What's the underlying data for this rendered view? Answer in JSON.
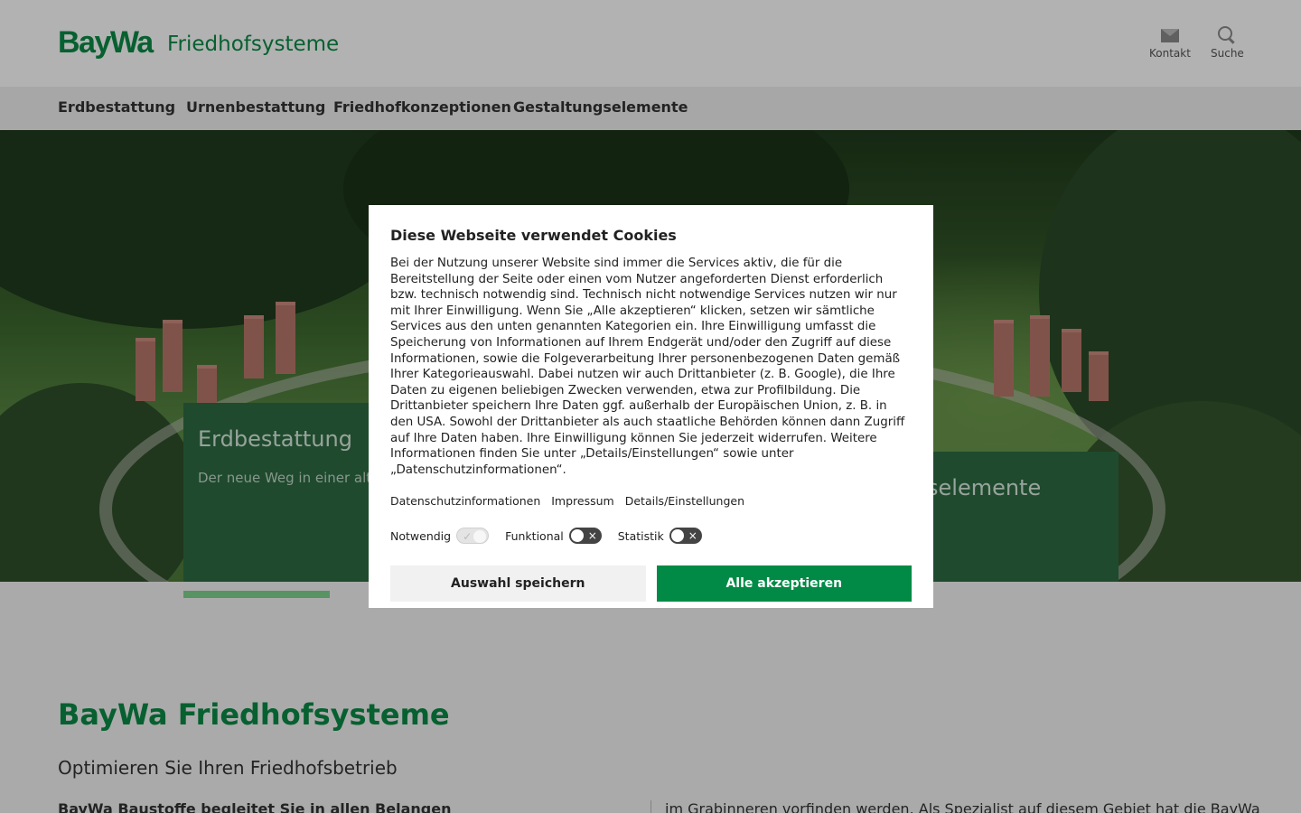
{
  "header": {
    "logo": "BayWa",
    "site_name": "Friedhofsysteme",
    "kontakt_label": "Kontakt",
    "suche_label": "Suche"
  },
  "nav": {
    "items": [
      {
        "label": "Erdbestattung"
      },
      {
        "label": "Urnenbestattung"
      },
      {
        "label": "Friedhofkonzeptionen"
      },
      {
        "label": "Gestaltungselemente"
      }
    ]
  },
  "hero": {
    "cards": [
      {
        "title": "Erdbestattung",
        "text": "Der neue Weg in einer alte"
      },
      {
        "title": "selemente"
      }
    ]
  },
  "content": {
    "title": "BayWa Friedhofsysteme",
    "subtitle": "Optimieren Sie Ihren Friedhofsbetrieb",
    "bold_text": "BayWa Baustoffe begleitet Sie in allen Belangen",
    "right_text": "im Grabinneren vorfinden werden. Als Spezialist auf diesem Gebiet hat die BayWa"
  },
  "cookie_dialog": {
    "title": "Diese Webseite verwendet Cookies",
    "body": "Bei der Nutzung unserer Website sind immer die Services aktiv, die für die Bereitstellung der Seite oder einen vom Nutzer angeforderten Dienst erforderlich bzw. technisch notwendig sind. Technisch nicht notwendige Services nutzen wir nur mit Ihrer Einwilligung. Wenn Sie „Alle akzeptieren“ klicken, setzen wir sämtliche Services aus den unten genannten Kategorien ein. Ihre Einwilligung umfasst die Speicherung von Informationen auf Ihrem Endgerät und/oder den Zugriff auf diese Informationen, sowie die Folgeverarbeitung Ihrer personenbezogenen Daten gemäß Ihrer Kategorieauswahl. Dabei nutzen wir auch Drittanbieter (z. B. Google), die Ihre Daten zu eigenen beliebigen Zwecken verwenden, etwa zur Profilbildung. Die Drittanbieter speichern Ihre Daten ggf. außerhalb der Europäischen Union, z. B. in den USA. Sowohl der Drittanbieter als auch staatliche Behörden können dann Zugriff auf Ihre Daten haben. Ihre Einwilligung können Sie jederzeit widerrufen. Weitere Informationen finden Sie unter „Details/Einstellungen“ sowie unter „Datenschutzinformationen“.",
    "links": {
      "datenschutz": "Datenschutzinformationen",
      "impressum": "Impressum",
      "details": "Details/Einstellungen"
    },
    "toggles": {
      "notwendig": {
        "label": "Notwendig",
        "state": "on-disabled"
      },
      "funktional": {
        "label": "Funktional",
        "state": "off"
      },
      "statistik": {
        "label": "Statistik",
        "state": "off"
      }
    },
    "buttons": {
      "save": "Auswahl speichern",
      "accept_all": "Alle akzeptieren"
    }
  },
  "colors": {
    "brand_green": "#0b8a45",
    "accept_button": "#008a45",
    "card_green": "#2d6b42",
    "card_bar": "#7fd38f"
  }
}
